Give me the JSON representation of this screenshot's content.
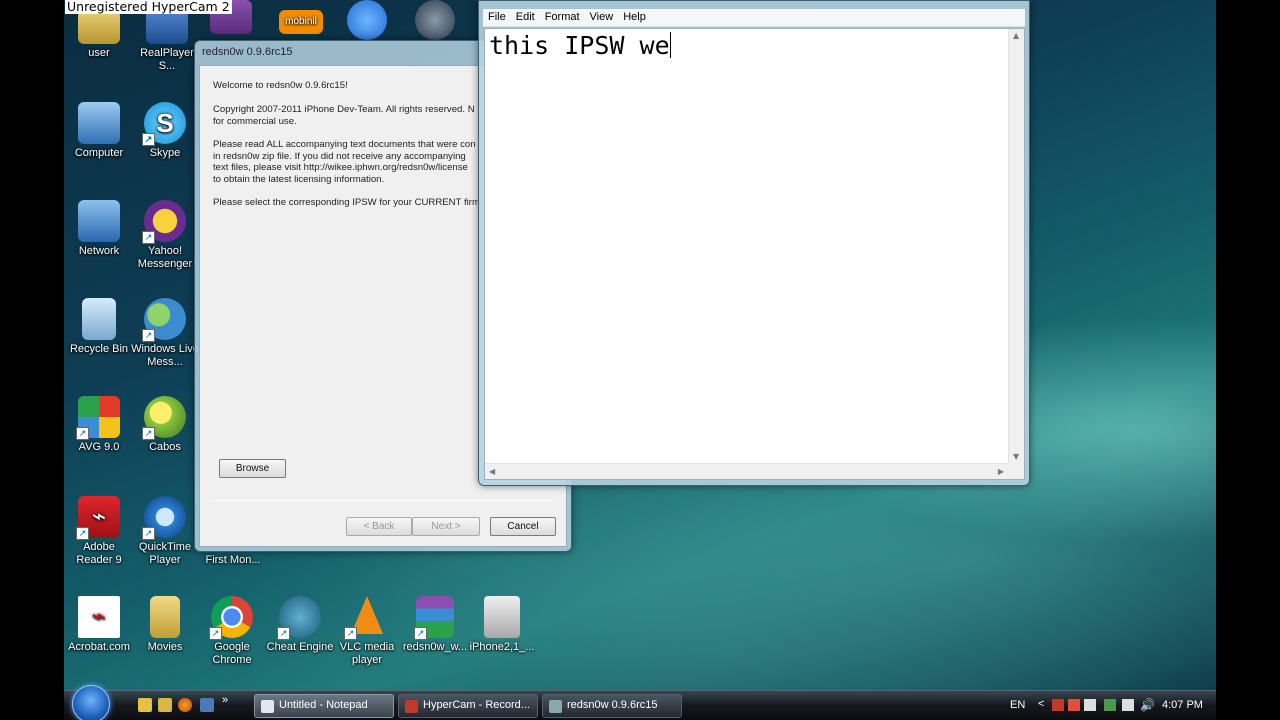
{
  "watermark": "Unregistered HyperCam 2",
  "desktop_icons": [
    {
      "label": "user",
      "icon": "folder-icon",
      "color": "#c9a640"
    },
    {
      "label": "RealPlayer S...",
      "icon": "realplayer-icon",
      "color": "#2b5fa8"
    },
    {
      "label": "Computer",
      "icon": "computer-icon",
      "color": "#4a90d9"
    },
    {
      "label": "Skype",
      "icon": "skype-icon",
      "color": "#21a9e8"
    },
    {
      "label": "Network",
      "icon": "network-icon",
      "color": "#3c7fcf"
    },
    {
      "label": "Yahoo! Messenger",
      "icon": "yahoo-icon",
      "color": "#6b2c91"
    },
    {
      "label": "Recycle Bin",
      "icon": "recycle-bin-icon",
      "color": "#8ab4d8"
    },
    {
      "label": "Windows Live Mess...",
      "icon": "live-messenger-icon",
      "color": "#55a845"
    },
    {
      "label": "AVG 9.0",
      "icon": "avg-icon",
      "color": "#e8a020"
    },
    {
      "label": "Cabos",
      "icon": "cabos-icon",
      "color": "#8bc53f"
    },
    {
      "label": "Adobe Reader 9",
      "icon": "adobe-reader-icon",
      "color": "#c4161c"
    },
    {
      "label": "QuickTime Player",
      "icon": "quicktime-icon",
      "color": "#2a7ed3"
    },
    {
      "label": "First Mon...",
      "icon": "document-icon",
      "color": "#5a6f7f"
    },
    {
      "label": "Acrobat.com",
      "icon": "acrobat-icon",
      "color": "#ffffff"
    },
    {
      "label": "Movies",
      "icon": "folder-icon",
      "color": "#d8b64a"
    },
    {
      "label": "Google Chrome",
      "icon": "chrome-icon",
      "color": "#dd4b39"
    },
    {
      "label": "Cheat Engine",
      "icon": "cheat-engine-icon",
      "color": "#2a6e8c"
    },
    {
      "label": "VLC media player",
      "icon": "vlc-icon",
      "color": "#f08c14"
    },
    {
      "label": "redsn0w_w...",
      "icon": "winrar-icon",
      "color": "#6a3a8c"
    },
    {
      "label": "iPhone2,1_...",
      "icon": "ipsw-file-icon",
      "color": "#d0d0d0"
    }
  ],
  "top_icons": [
    {
      "label": "mobinil",
      "icon": "mobinil-icon",
      "color": "#f28c00"
    },
    {
      "label": "iTunes",
      "icon": "itunes-icon",
      "color": "#1f6ad3"
    },
    {
      "label": "Steam",
      "icon": "steam-icon",
      "color": "#3a4a5a"
    }
  ],
  "redsn0w": {
    "title": "redsn0w 0.9.6rc15",
    "welcome": "Welcome to redsn0w 0.9.6rc15!",
    "copyright": "Copyright 2007-2011 iPhone Dev-Team. All rights reserved. N\nfor commercial use.",
    "instructions": "Please read ALL accompanying text documents that were con\nin redsn0w zip file. If you did not receive any accompanying\ntext files, please visit http://wikee.iphwn.org/redsn0w/license\nto obtain the latest licensing information.",
    "select_prompt": "Please select the corresponding IPSW for your CURRENT firm",
    "browse": "Browse",
    "back": "< Back",
    "next": "Next >",
    "cancel": "Cancel"
  },
  "notepad": {
    "menu": [
      "File",
      "Edit",
      "Format",
      "View",
      "Help"
    ],
    "content": "this IPSW we"
  },
  "taskbar": {
    "tasks": [
      {
        "label": "Untitled - Notepad",
        "icon": "notepad-icon",
        "color": "#dfe8f0",
        "active": true
      },
      {
        "label": "HyperCam - Record...",
        "icon": "hypercam-icon",
        "color": "#c0392b",
        "active": false
      },
      {
        "label": "redsn0w 0.9.6rc15",
        "icon": "redsn0w-icon",
        "color": "#8aa",
        "active": false
      }
    ],
    "language": "EN",
    "time": "4:07 PM"
  }
}
